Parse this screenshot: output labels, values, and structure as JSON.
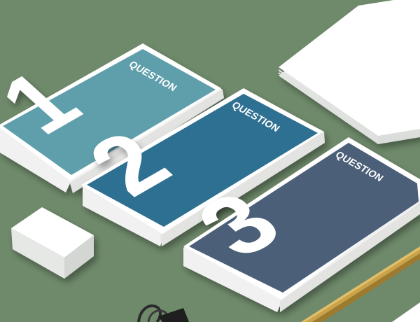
{
  "scene": {
    "background_color": "#6f8a6b"
  },
  "cards": [
    {
      "label": "QUESTION",
      "number": "1",
      "color": "#5e9fac"
    },
    {
      "label": "QUESTION",
      "number": "2",
      "color": "#2f6f92"
    },
    {
      "label": "QUESTION",
      "number": "3",
      "color": "#4c5f78"
    }
  ],
  "objects": [
    {
      "name": "eraser"
    },
    {
      "name": "paper-stack"
    },
    {
      "name": "pencil"
    },
    {
      "name": "binder-clip"
    }
  ]
}
